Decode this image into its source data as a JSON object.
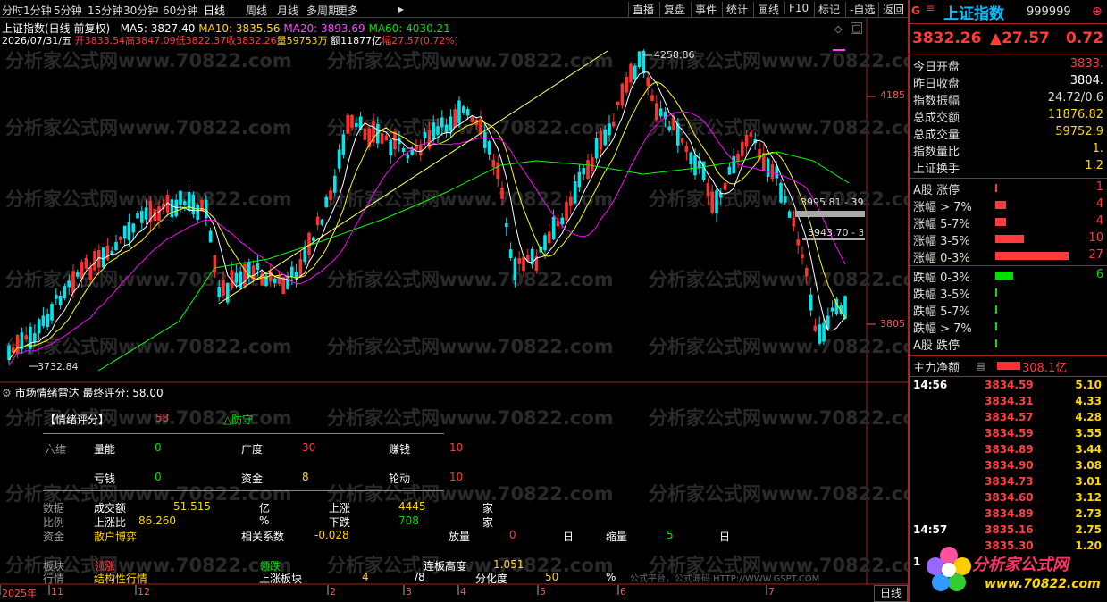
{
  "toolbar": {
    "tabs": [
      "分时",
      "1分钟",
      "5分钟",
      "15分钟",
      "30分钟",
      "60分钟",
      "日线",
      "周线",
      "月线",
      "多周期",
      "更多"
    ],
    "active": "日线",
    "right_buttons": [
      "直播",
      "复盘",
      "事件",
      "统计",
      "画线",
      "F10",
      "标记",
      "-自选",
      "返回"
    ]
  },
  "header": {
    "title": "上证指数(日线 前复权)",
    "ma5": "MA5: 3827.40",
    "ma10": "MA10: 3835.56",
    "ma20": "MA20: 3893.69",
    "ma60": "MA60: 4030.21",
    "date": "2026/07/31/五",
    "open": "开3833.54",
    "high": "高3847.09",
    "low": "低3822.37",
    "close": "收3832.26",
    "volume": "量59753万",
    "amount": "额11877亿",
    "change": "幅27.57(0.72%)"
  },
  "watermark": "分析家公式网www.70822.com",
  "chart_data": {
    "type": "candlestick",
    "annotations": {
      "high": "4258.86",
      "low": "3732.84",
      "level1": "3995.81 - 398",
      "level2": "3943.70 - 3"
    },
    "price_axis": [
      "4185",
      "3805"
    ],
    "date_axis": [
      "2025年",
      "11",
      "12",
      "2",
      "3",
      "4",
      "5",
      "6",
      "7"
    ],
    "period_label": "日线",
    "colors": {
      "up": "#ff3030",
      "down": "#00e5ee",
      "ma5": "#ffffff",
      "ma10": "#ffff00",
      "ma20": "#ff00ff",
      "ma60": "#00ff00"
    }
  },
  "indicator": {
    "title": "市场情绪雷达",
    "score": "最终评分: 58.00",
    "label_score": "【情绪评分】",
    "score_val": "58",
    "defense": "△防守",
    "six": "六维",
    "items": [
      {
        "k": "量能",
        "v": "0"
      },
      {
        "k": "广度",
        "v": "30"
      },
      {
        "k": "赚钱",
        "v": "10"
      },
      {
        "k": "亏钱",
        "v": "0"
      },
      {
        "k": "资金",
        "v": "8"
      },
      {
        "k": "轮动",
        "v": "10"
      }
    ],
    "data_lbl": "数据",
    "ratio_lbl": "比例",
    "fund_lbl": "资金",
    "amount_k": "成交额",
    "amount_v": "51.515",
    "amount_u": "亿",
    "up_k": "上涨",
    "up_v": "4445",
    "up_u": "家",
    "upr_k": "上涨比",
    "upr_v": "86.260",
    "upr_u": "%",
    "down_k": "下跌",
    "down_v": "708",
    "down_u": "家",
    "retail": "散户博弈",
    "corr_k": "相关系数",
    "corr_v": "-0.028",
    "vol_up_k": "放量",
    "vol_up_v": "0",
    "vol_up_u": "日",
    "vol_dn_k": "缩量",
    "vol_dn_v": "5",
    "vol_dn_u": "日",
    "block_lbl": "板块",
    "market_lbl": "行情",
    "lead_up": "领涨",
    "lead_dn": "领跌",
    "board_k": "连板高度",
    "board_v": "1.051",
    "struct": "结构性行情",
    "up_blocks_k": "上涨板块",
    "up_blocks_v": "4",
    "up_blocks_t": "/8",
    "div_k": "分化度",
    "div_v": "50",
    "div_u": "%",
    "platform": "公式平台，公式源码 HTTP://WWW.GSPT.COM"
  },
  "quote": {
    "g": "G",
    "name": "上证指数",
    "code": "999999",
    "price": "3832.26",
    "change": "▲27.57",
    "pct": "0.72",
    "rows": [
      {
        "k": "今日开盘",
        "v": "3833.",
        "c": "#ff3b3b"
      },
      {
        "k": "昨日收盘",
        "v": "3804.",
        "c": "#ffffff"
      },
      {
        "k": "指数振幅",
        "v": "24.72/0.6",
        "c": "#dddddd"
      },
      {
        "k": "总成交额",
        "v": "11876.82",
        "c": "#ffd700"
      },
      {
        "k": "总成交量",
        "v": "59752.9",
        "c": "#ffd700"
      },
      {
        "k": "指数量比",
        "v": "1.",
        "c": "#ffd700"
      },
      {
        "k": "上证换手",
        "v": "1.2",
        "c": "#ffd700"
      }
    ],
    "breadth": [
      {
        "k": "A股 涨停",
        "v": "1",
        "c": "#ff3b3b",
        "w": 2
      },
      {
        "k": "涨幅 > 7%",
        "v": "4",
        "c": "#ff3b3b",
        "w": 12
      },
      {
        "k": "涨幅 5-7%",
        "v": "4",
        "c": "#ff3b3b",
        "w": 12
      },
      {
        "k": "涨幅 3-5%",
        "v": "10",
        "c": "#ff3b3b",
        "w": 32
      },
      {
        "k": "涨幅 0-3%",
        "v": "27",
        "c": "#ff3b3b",
        "w": 82
      }
    ],
    "breadth2": [
      {
        "k": "跌幅 0-3%",
        "v": "6",
        "c": "#00e000",
        "w": 20
      },
      {
        "k": "跌幅 3-5%",
        "v": "",
        "c": "#00e000",
        "w": 2
      },
      {
        "k": "跌幅 5-7%",
        "v": "",
        "c": "#00e000",
        "w": 2
      },
      {
        "k": "跌幅 > 7%",
        "v": "",
        "c": "#00e000",
        "w": 2
      },
      {
        "k": "A股 跌停",
        "v": "",
        "c": "#00e000",
        "w": 2
      }
    ],
    "netflow_k": "主力净额",
    "netflow_v": "308.1亿",
    "ticks": [
      {
        "t": "14:56",
        "p": "3834.59",
        "v": "5.10"
      },
      {
        "t": "",
        "p": "3834.31",
        "v": "4.33"
      },
      {
        "t": "",
        "p": "3834.57",
        "v": "4.28"
      },
      {
        "t": "",
        "p": "3834.59",
        "v": "3.55"
      },
      {
        "t": "",
        "p": "3834.89",
        "v": "3.44"
      },
      {
        "t": "",
        "p": "3834.90",
        "v": "3.08"
      },
      {
        "t": "",
        "p": "3834.73",
        "v": "3.01"
      },
      {
        "t": "",
        "p": "3834.60",
        "v": "3.12"
      },
      {
        "t": "",
        "p": "3834.89",
        "v": "2.73"
      },
      {
        "t": "14:57",
        "p": "3835.16",
        "v": "2.75"
      },
      {
        "t": "",
        "p": "3835.30",
        "v": "1.20"
      },
      {
        "t": "1",
        "p": "",
        "v": ""
      }
    ],
    "logo_text": "分析家公式网",
    "logo_url": "www.70822.com"
  }
}
